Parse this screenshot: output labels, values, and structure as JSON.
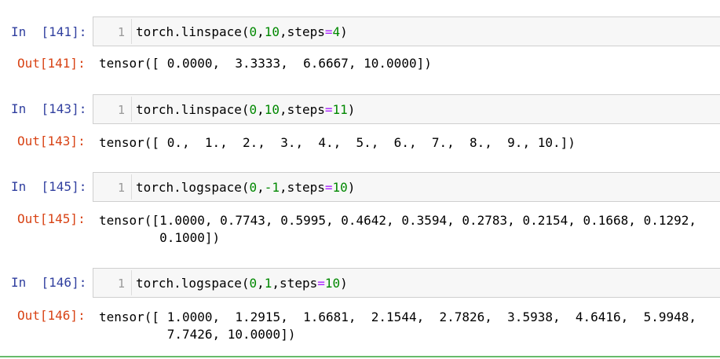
{
  "cells": [
    {
      "in_prompt": "In  [141]:",
      "line_number": "1",
      "code_prefix": "torch.linspace(",
      "arg1": "0",
      "comma1": ",",
      "arg2": "10",
      "comma2": ",steps",
      "eq": "=",
      "arg3": "4",
      "code_suffix": ")",
      "out_prompt": "Out[141]:",
      "output": "tensor([ 0.0000,  3.3333,  6.6667, 10.0000])"
    },
    {
      "in_prompt": "In  [143]:",
      "line_number": "1",
      "code_prefix": "torch.linspace(",
      "arg1": "0",
      "comma1": ",",
      "arg2": "10",
      "comma2": ",steps",
      "eq": "=",
      "arg3": "11",
      "code_suffix": ")",
      "out_prompt": "Out[143]:",
      "output": "tensor([ 0.,  1.,  2.,  3.,  4.,  5.,  6.,  7.,  8.,  9., 10.])"
    },
    {
      "in_prompt": "In  [145]:",
      "line_number": "1",
      "code_prefix": "torch.logspace(",
      "arg1": "0",
      "comma1": ",",
      "arg2": "-1",
      "comma2": ",steps",
      "eq": "=",
      "arg3": "10",
      "code_suffix": ")",
      "out_prompt": "Out[145]:",
      "output": "tensor([1.0000, 0.7743, 0.5995, 0.4642, 0.3594, 0.2783, 0.2154, 0.1668, 0.1292,\n        0.1000])"
    },
    {
      "in_prompt": "In  [146]:",
      "line_number": "1",
      "code_prefix": "torch.logspace(",
      "arg1": "0",
      "comma1": ",",
      "arg2": "1",
      "comma2": ",steps",
      "eq": "=",
      "arg3": "10",
      "code_suffix": ")",
      "out_prompt": "Out[146]:",
      "output": "tensor([ 1.0000,  1.2915,  1.6681,  2.1544,  2.7826,  3.5938,  4.6416,  5.9948,\n         7.7426, 10.0000])"
    }
  ]
}
